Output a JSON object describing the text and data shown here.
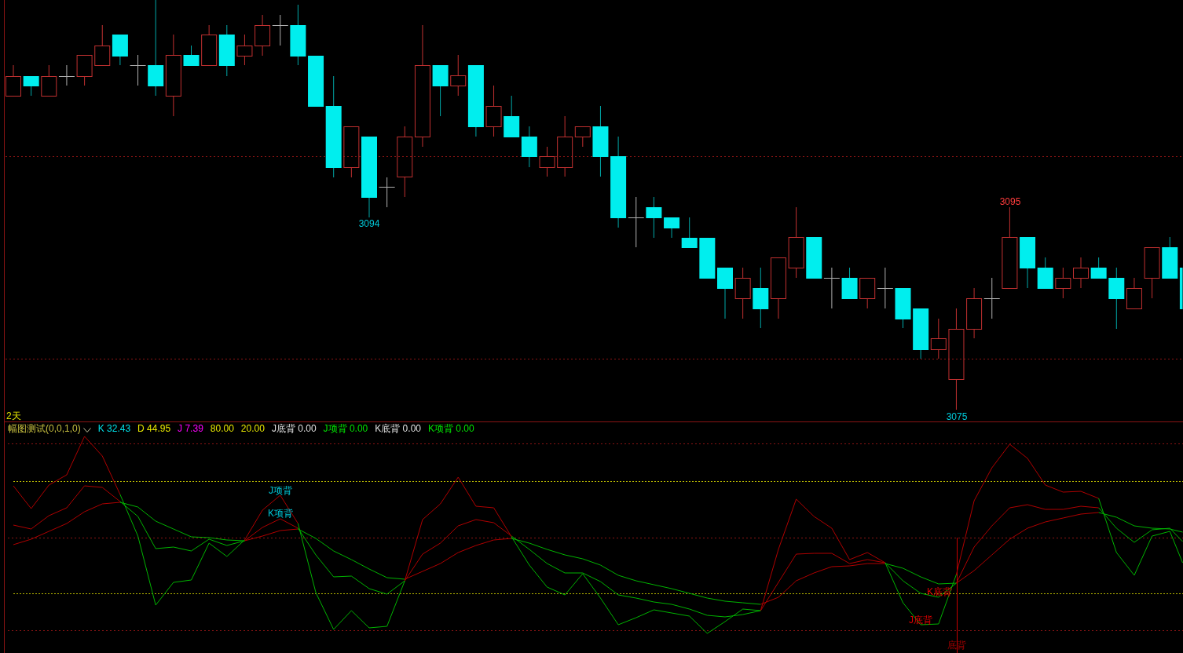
{
  "price_chart": {
    "period": "2天",
    "price_labels": [
      {
        "text": "3094",
        "color": "#00c8d8"
      },
      {
        "text": "3075",
        "color": "#00c8d8"
      },
      {
        "text": "3095",
        "color": "#ff3c3c"
      }
    ]
  },
  "indicator": {
    "title": "幅图测试(0,0,1,0)",
    "values": [
      {
        "text": "K 32.43",
        "color": "#00e0e8"
      },
      {
        "text": "D 44.95",
        "color": "#e8e800"
      },
      {
        "text": "J 7.39",
        "color": "#ff00ff"
      },
      {
        "text": "80.00",
        "color": "#e8e800"
      },
      {
        "text": "20.00",
        "color": "#e8e800"
      },
      {
        "text": "J底背 0.00",
        "color": "#e0e0e0"
      },
      {
        "text": "J项背 0.00",
        "color": "#00e600"
      },
      {
        "text": "K底背 0.00",
        "color": "#e0e0e0"
      },
      {
        "text": "K项背 0.00",
        "color": "#00e600"
      }
    ],
    "signals": [
      {
        "text": "J项背",
        "color": "#00c8d8"
      },
      {
        "text": "K项背",
        "color": "#00c8d8"
      },
      {
        "text": "K底背",
        "color": "#e00000"
      },
      {
        "text": "J底背",
        "color": "#e00000"
      },
      {
        "text": "底背",
        "color": "#a00000"
      }
    ]
  }
}
